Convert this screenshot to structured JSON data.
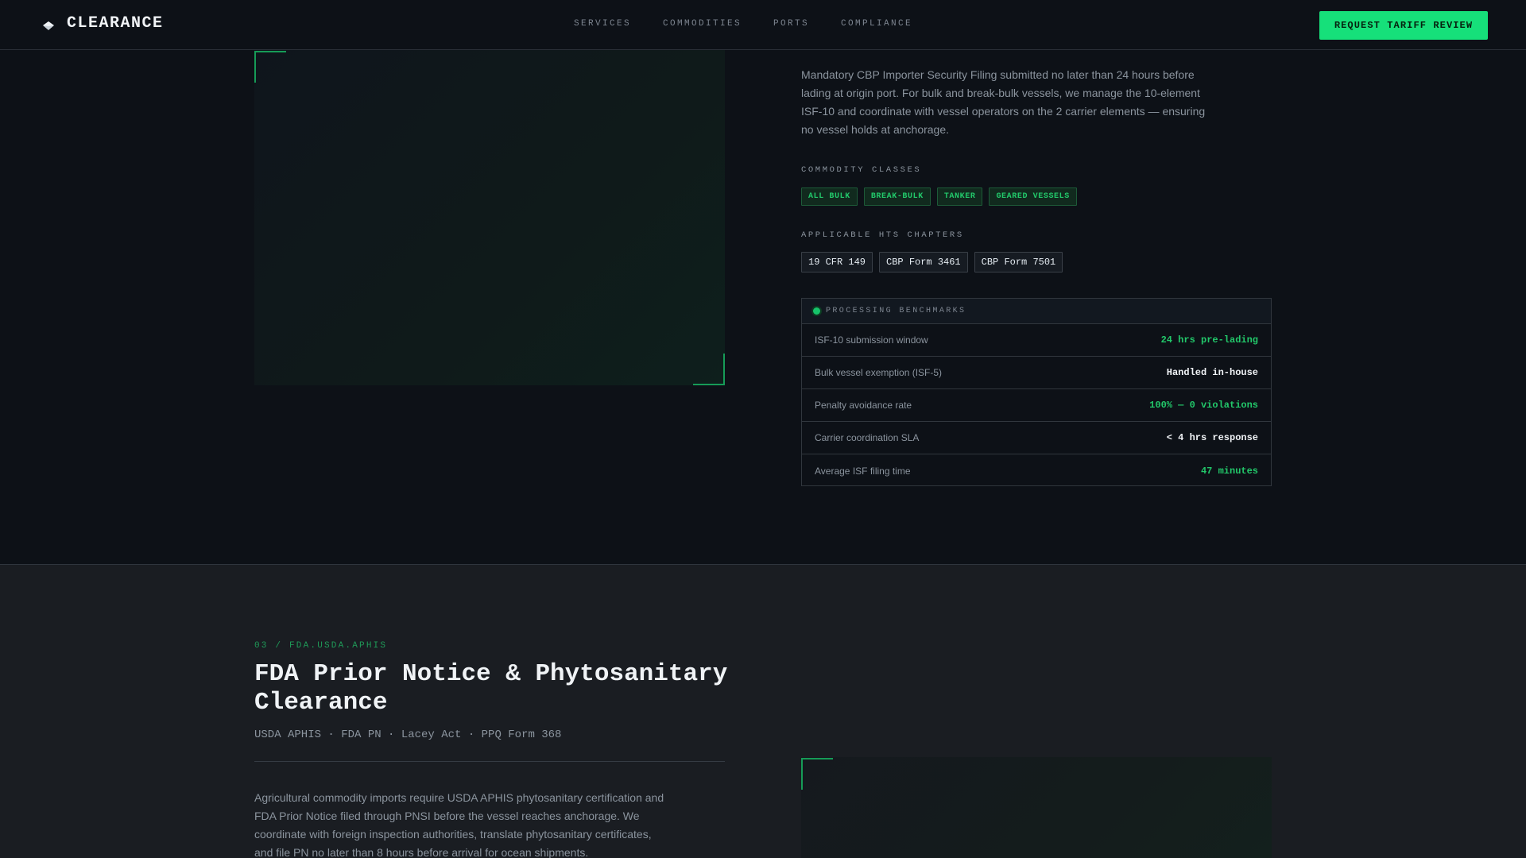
{
  "nav": {
    "brand": "CLEARANCE",
    "brand_icon": "diamond-logo-icon",
    "links": [
      "SERVICES",
      "COMMODITIES",
      "PORTS",
      "COMPLIANCE"
    ],
    "cta": "REQUEST TARIFF REVIEW"
  },
  "section1": {
    "description": "Mandatory CBP Importer Security Filing submitted no later than 24 hours before lading at origin port. For bulk and break-bulk vessels, we manage the 10-element ISF-10 and coordinate with vessel operators on the 2 carrier elements — ensuring no vessel holds at anchorage.",
    "commodity_label": "COMMODITY CLASSES",
    "commodity_tags": [
      "ALL BULK",
      "BREAK-BULK",
      "TANKER",
      "GEARED VESSELS"
    ],
    "hts_label": "APPLICABLE HTS CHAPTERS",
    "hts_tags": [
      "19 CFR 149",
      "CBP Form 3461",
      "CBP Form 7501"
    ],
    "benchmarks": {
      "title": "PROCESSING BENCHMARKS",
      "rows": [
        {
          "key": "ISF-10 submission window",
          "value": "24 hrs pre-lading",
          "tone": "green"
        },
        {
          "key": "Bulk vessel exemption (ISF-5)",
          "value": "Handled in-house",
          "tone": "white"
        },
        {
          "key": "Penalty avoidance rate",
          "value": "100% — 0 violations",
          "tone": "green"
        },
        {
          "key": "Carrier coordination SLA",
          "value": "< 4 hrs response",
          "tone": "white"
        },
        {
          "key": "Average ISF filing time",
          "value": "47 minutes",
          "tone": "green"
        }
      ]
    }
  },
  "section2": {
    "eyebrow": "03 / FDA.USDA.APHIS",
    "title": "FDA Prior Notice & Phytosanitary Clearance",
    "subtitle": "USDA APHIS · FDA PN · Lacey Act · PPQ Form 368",
    "description": "Agricultural commodity imports require USDA APHIS phytosanitary certification and FDA Prior Notice filed through PNSI before the vessel reaches anchorage. We coordinate with foreign inspection authorities, translate phytosanitary certificates, and file PN no later than 8 hours before arrival for ocean shipments."
  },
  "colors": {
    "background": "#0d1117",
    "section_alt": "#1a1d22",
    "accent": "#16e07a",
    "accent_text": "#22c86a"
  }
}
